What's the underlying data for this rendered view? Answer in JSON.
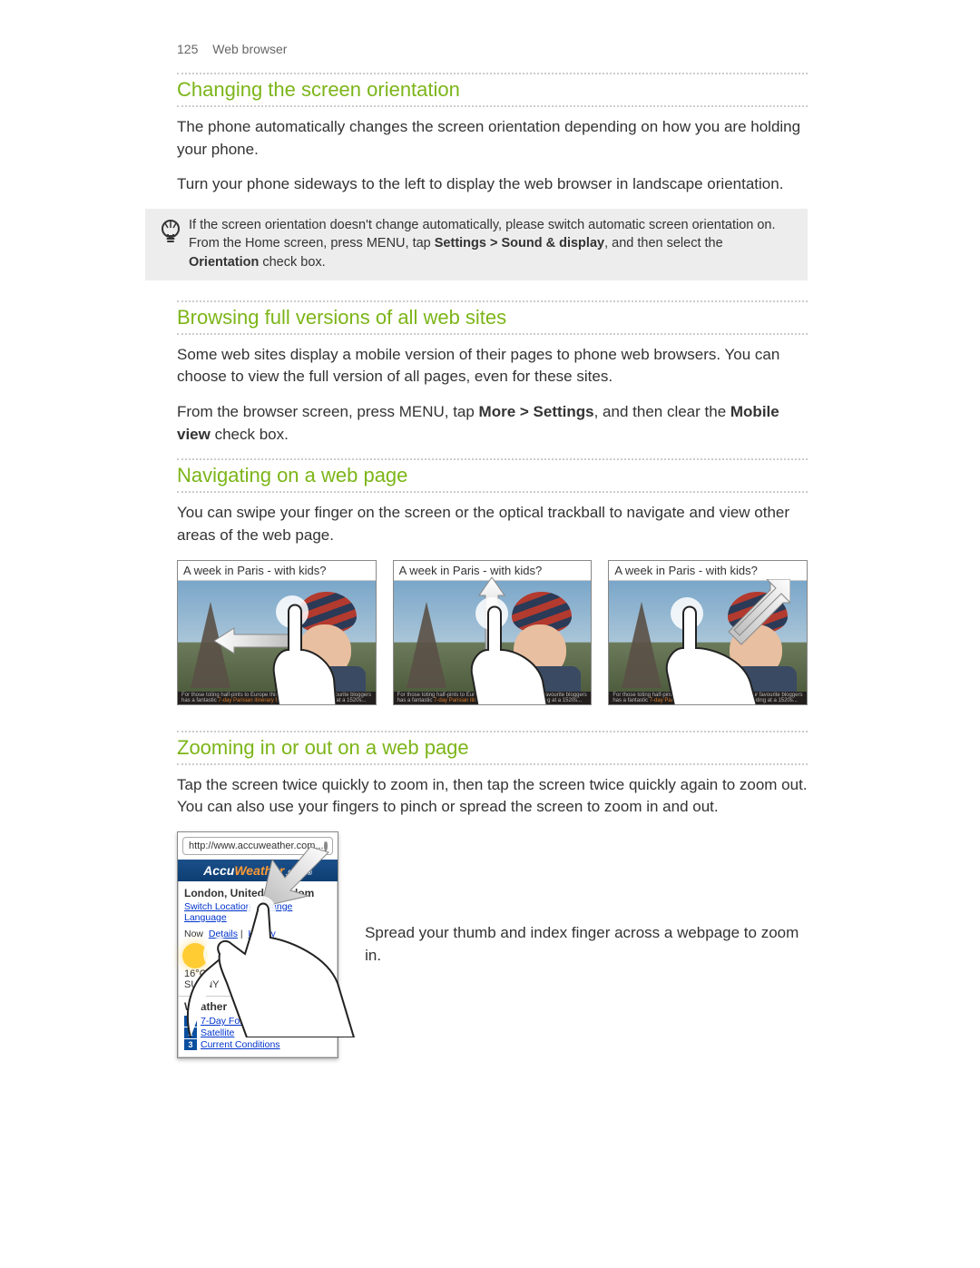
{
  "header": {
    "page_number": "125",
    "section": "Web browser"
  },
  "s1": {
    "title": "Changing the screen orientation",
    "p1": "The phone automatically changes the screen orientation depending on how you are holding your phone.",
    "p2": "Turn your phone sideways to the left to display the web browser in landscape orientation."
  },
  "tip": {
    "pre": "If the screen orientation doesn't change automatically, please switch automatic screen orientation on. From the Home screen, press MENU, tap ",
    "bold1": "Settings > Sound & display",
    "mid": ", and then select the ",
    "bold2": "Orientation",
    "post": " check box."
  },
  "s2": {
    "title": "Browsing full versions of all web sites",
    "p1": "Some web sites display a mobile version of their pages to phone web browsers. You can choose to view the full version of all pages, even for these sites.",
    "p2a": "From the browser screen, press MENU, tap ",
    "p2b": "More > Settings",
    "p2c": ", and then clear the ",
    "p2d": "Mobile view",
    "p2e": " check box."
  },
  "s3": {
    "title": "Navigating on a web page",
    "p1": "You can swipe your finger on the screen or the optical trackball to navigate and view other areas of the web page.",
    "thumb_title": "A week in Paris - with kids?",
    "thumb_footer_a": "For those toting half-pints to Europe this summer, one of our favourite bloggers has a fantastic ",
    "thumb_footer_hl": "7-day Parisian itinerary for you",
    "thumb_footer_b": " - including eating at a 1520s..."
  },
  "s4": {
    "title": "Zooming in or out on a web page",
    "p1": "Tap the screen twice quickly to zoom in, then tap the screen twice quickly again to zoom out. You can also use your fingers to pinch or spread the screen to zoom in and out.",
    "phone": {
      "url": "http://www.accuweather.com...",
      "brand_a": "Accu",
      "brand_b": "Weather",
      "brand_c": ".com",
      "location": "London, United Kingdom",
      "link_switch": "Switch Location",
      "link_lang": "Change Language",
      "now": "Now",
      "details": "Details",
      "hourly": "Hourly",
      "temp": "16°C",
      "cond": "SUNNY",
      "weath": "Weather",
      "f1": "7-Day Forecast",
      "f2": "Satellite",
      "f3": "Current Conditions"
    },
    "caption": "Spread your thumb and index finger across a webpage to zoom in."
  }
}
